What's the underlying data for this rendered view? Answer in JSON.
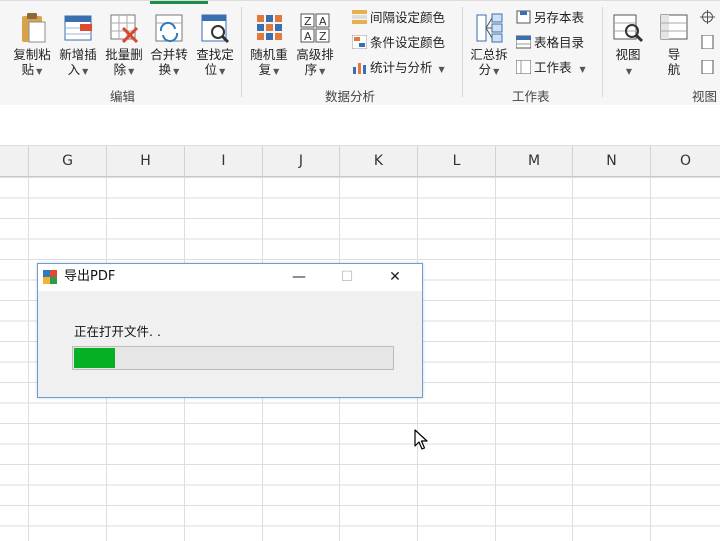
{
  "ribbon": {
    "edit_group": {
      "label": "编辑",
      "buttons": [
        {
          "l1": "复制粘",
          "l2": "贴"
        },
        {
          "l1": "新增插",
          "l2": "入"
        },
        {
          "l1": "批量删",
          "l2": "除"
        },
        {
          "l1": "合并转",
          "l2": "换"
        },
        {
          "l1": "查找定",
          "l2": "位"
        }
      ]
    },
    "data_group": {
      "label": "数据分析",
      "buttons": [
        {
          "l1": "随机重",
          "l2": "复"
        },
        {
          "l1": "高级排",
          "l2": "序"
        }
      ],
      "small": [
        "间隔设定颜色",
        "条件设定颜色",
        "统计与分析"
      ]
    },
    "sheet_group": {
      "label": "工作表",
      "summary": {
        "l1": "汇总拆",
        "l2": "分"
      },
      "small": [
        "另存本表",
        "表格目录",
        "工作表"
      ]
    },
    "view_group": {
      "label": "视图",
      "buttons": [
        {
          "l1": "视图",
          "l2": ""
        },
        {
          "l1": "导",
          "l2": "航"
        }
      ]
    }
  },
  "columns": [
    "G",
    "H",
    "I",
    "J",
    "K",
    "L",
    "M",
    "N",
    "O"
  ],
  "dialog": {
    "title": "导出PDF",
    "status": "正在打开文件. .",
    "progress": 0.13,
    "minimize": "—",
    "maximize": "☐",
    "close": "✕"
  },
  "colors": {
    "accent": "#1e8d4a",
    "progress": "#06b025",
    "dialog_border": "#6a9fd4"
  }
}
